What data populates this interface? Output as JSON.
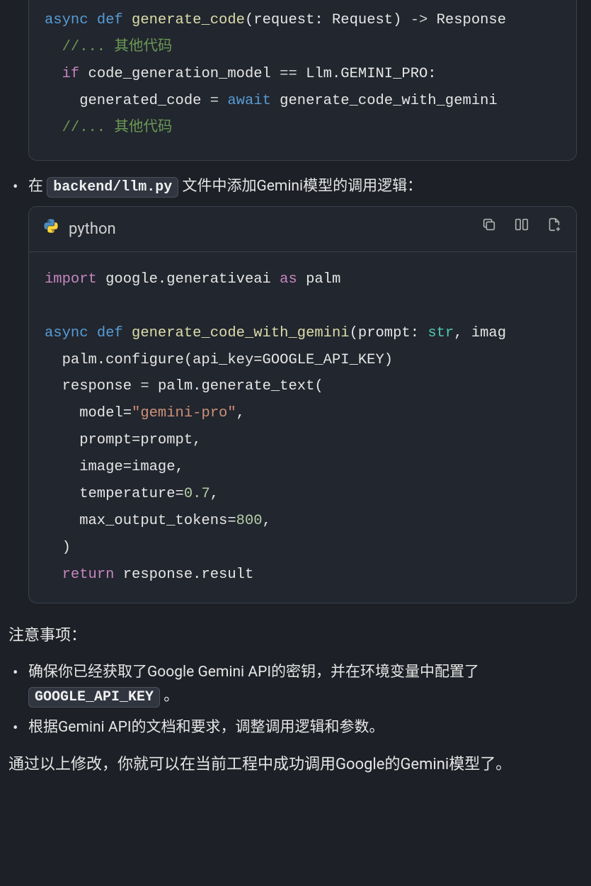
{
  "code_block_1": {
    "tokens": [
      {
        "t": "async ",
        "c": "kwdef"
      },
      {
        "t": "def ",
        "c": "kwdef"
      },
      {
        "t": "generate_code",
        "c": "fn"
      },
      {
        "t": "(request: Request) ",
        "c": ""
      },
      {
        "t": "-> ",
        "c": "op"
      },
      {
        "t": "Response",
        "c": ""
      },
      {
        "t": "\n",
        "c": ""
      },
      {
        "t": "  //... 其他代码",
        "c": "com"
      },
      {
        "t": "\n",
        "c": ""
      },
      {
        "t": "  ",
        "c": ""
      },
      {
        "t": "if",
        "c": "kw"
      },
      {
        "t": " code_generation_model ",
        "c": ""
      },
      {
        "t": "==",
        "c": "op"
      },
      {
        "t": " Llm.GEMINI_PRO:",
        "c": ""
      },
      {
        "t": "\n",
        "c": ""
      },
      {
        "t": "    generated_code ",
        "c": ""
      },
      {
        "t": "= ",
        "c": "op"
      },
      {
        "t": "await",
        "c": "kwdef"
      },
      {
        "t": " generate_code_with_gemini",
        "c": ""
      },
      {
        "t": "\n",
        "c": ""
      },
      {
        "t": "  //... 其他代码",
        "c": "com"
      }
    ]
  },
  "bullet_1": {
    "prefix": "在 ",
    "code": "backend/llm.py",
    "suffix": " 文件中添加Gemini模型的调用逻辑："
  },
  "code_block_2": {
    "language": "python",
    "tokens": [
      {
        "t": "import",
        "c": "kw"
      },
      {
        "t": " google.generativeai ",
        "c": ""
      },
      {
        "t": "as",
        "c": "kw"
      },
      {
        "t": " palm",
        "c": ""
      },
      {
        "t": "\n",
        "c": ""
      },
      {
        "t": "\n",
        "c": ""
      },
      {
        "t": "async ",
        "c": "kwdef"
      },
      {
        "t": "def ",
        "c": "kwdef"
      },
      {
        "t": "generate_code_with_gemini",
        "c": "fn"
      },
      {
        "t": "(prompt: ",
        "c": ""
      },
      {
        "t": "str",
        "c": "cls"
      },
      {
        "t": ", imag",
        "c": ""
      },
      {
        "t": "\n",
        "c": ""
      },
      {
        "t": "  palm.configure(api_key=GOOGLE_API_KEY)",
        "c": ""
      },
      {
        "t": "\n",
        "c": ""
      },
      {
        "t": "  response ",
        "c": ""
      },
      {
        "t": "=",
        "c": "op"
      },
      {
        "t": " palm.generate_text(",
        "c": ""
      },
      {
        "t": "\n",
        "c": ""
      },
      {
        "t": "    model=",
        "c": ""
      },
      {
        "t": "\"gemini-pro\"",
        "c": "str"
      },
      {
        "t": ",",
        "c": ""
      },
      {
        "t": "\n",
        "c": ""
      },
      {
        "t": "    prompt=prompt,",
        "c": ""
      },
      {
        "t": "\n",
        "c": ""
      },
      {
        "t": "    image=image,",
        "c": ""
      },
      {
        "t": "\n",
        "c": ""
      },
      {
        "t": "    temperature=",
        "c": ""
      },
      {
        "t": "0.7",
        "c": "num"
      },
      {
        "t": ",",
        "c": ""
      },
      {
        "t": "\n",
        "c": ""
      },
      {
        "t": "    max_output_tokens=",
        "c": ""
      },
      {
        "t": "800",
        "c": "num"
      },
      {
        "t": ",",
        "c": ""
      },
      {
        "t": "\n",
        "c": ""
      },
      {
        "t": "  )",
        "c": ""
      },
      {
        "t": "\n",
        "c": ""
      },
      {
        "t": "  ",
        "c": ""
      },
      {
        "t": "return",
        "c": "kw"
      },
      {
        "t": " response.result",
        "c": ""
      }
    ]
  },
  "notes_heading": "注意事项：",
  "note_items": [
    {
      "prefix": "确保你已经获取了Google Gemini API的密钥，并在环境变量中配置了 ",
      "code": "GOOGLE_API_KEY",
      "suffix": " 。"
    },
    {
      "prefix": "根据Gemini API的文档和要求，调整调用逻辑和参数。",
      "code": "",
      "suffix": ""
    }
  ],
  "closing": "通过以上修改，你就可以在当前工程中成功调用Google的Gemini模型了。"
}
